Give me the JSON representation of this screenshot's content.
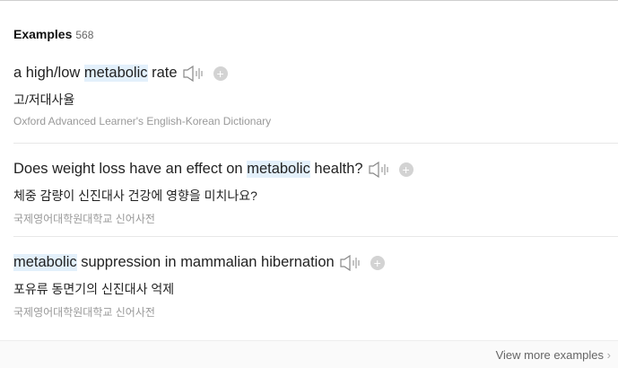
{
  "section": {
    "title": "Examples",
    "count": "568"
  },
  "examples": [
    {
      "before": "a high/low ",
      "highlight": "metabolic",
      "after": " rate",
      "translation": "고/저대사율",
      "source": "Oxford Advanced Learner's English-Korean Dictionary"
    },
    {
      "before": "Does weight loss have an effect on ",
      "highlight": "metabolic",
      "after": " health?",
      "translation": "체중 감량이 신진대사 건강에 영향을 미치나요?",
      "source": "국제영어대학원대학교 신어사전"
    },
    {
      "before": "",
      "highlight": "metabolic",
      "after": " suppression in mammalian hibernation",
      "translation": "포유류 동면기의 신진대사 억제",
      "source": "국제영어대학원대학교 신어사전"
    }
  ],
  "footer": {
    "view_more": "View more examples",
    "chevron": "›"
  },
  "icons": {
    "speaker": "speaker-icon",
    "add": "plus-circle-icon"
  }
}
